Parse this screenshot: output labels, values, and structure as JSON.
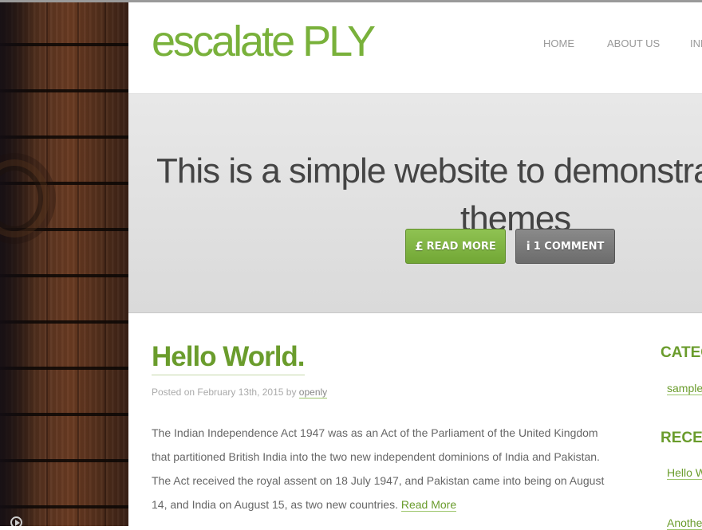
{
  "site": {
    "logo": "escalate PLY"
  },
  "nav": {
    "items": [
      "HOME",
      "ABOUT US",
      "IND"
    ]
  },
  "hero": {
    "title_line1": "This is a simple website to demonstrate",
    "title_line2": "themes",
    "read_more_icon": "£",
    "read_more_label": "READ MORE",
    "comment_icon": "i",
    "comment_label": "1 COMMENT"
  },
  "post": {
    "title": "Hello World.",
    "meta_prefix": "Posted on February 13th, 2015 by ",
    "author": "openly",
    "body_lines": [
      "The Indian Independence Act 1947 was as an Act of the Parliament of the United Kingdom",
      "that partitioned British India into the two new independent dominions of India and Pakistan.",
      "The Act received the royal assent on 18 July 1947, and Pakistan came into being on August",
      "14, and India on August 15, as two new countries. "
    ],
    "read_more": "Read More"
  },
  "sidebar": {
    "categories_title": "CATEG",
    "category_link": "sample",
    "recent_title": "RECEN",
    "recent_links": [
      "Hello W",
      "Anothe"
    ]
  },
  "icons": {
    "media": "play-circle-icon"
  }
}
